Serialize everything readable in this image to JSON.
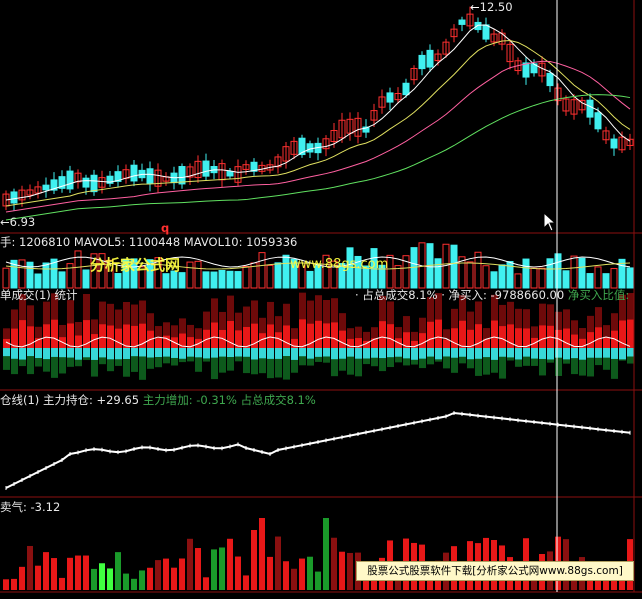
{
  "colors": {
    "background": "#000000",
    "up": "#ff3030",
    "down": "#40f0f0",
    "white": "#e8e8e8",
    "green": "#3fa84f",
    "yellow": "#e6e600",
    "divider": "#8b1010"
  },
  "price_panel": {
    "high_label": "12.50",
    "low_label": "6.93",
    "marker": "q"
  },
  "volume_panel": {
    "header": "手: 1206810  MAVOL5: 1100448  MAVOL10: 1059336"
  },
  "big_order_panel": {
    "title": "单成交(1)",
    "stats": "统计",
    "mid_text": "· 占总成交8.1%",
    "net_buy_label": "· 净买入:",
    "net_buy_value": "-9788660.00",
    "net_ratio_label": "净买入比值:"
  },
  "position_panel": {
    "title": "仓线(1)",
    "holding_label": "主力持仓:",
    "holding_value": "+29.65",
    "increase_label": "主力增加:",
    "increase_value": "-0.31%",
    "share_text": "占总成交8.1%"
  },
  "sentiment_panel": {
    "title": "卖气:",
    "value": "-3.12"
  },
  "watermark": {
    "site_name": "分析家公式网",
    "url": "www.88gs.com"
  },
  "banner_text": "股票公式股票软件下载[分析家公式网www.88gs.com]"
}
